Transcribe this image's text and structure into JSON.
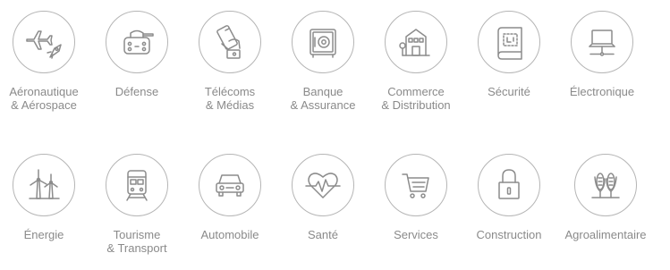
{
  "industries": [
    {
      "label": "Aéronautique\n& Aérospace",
      "icon": "airplane-rocket-icon"
    },
    {
      "label": "Défense",
      "icon": "tank-icon"
    },
    {
      "label": "Télécoms\n& Médias",
      "icon": "phone-hand-icon"
    },
    {
      "label": "Banque\n& Assurance",
      "icon": "safe-icon"
    },
    {
      "label": "Commerce\n& Distribution",
      "icon": "storefront-icon"
    },
    {
      "label": "Sécurité",
      "icon": "blueprint-icon"
    },
    {
      "label": "Électronique",
      "icon": "laptop-network-icon"
    },
    {
      "label": "Énergie",
      "icon": "wind-turbine-icon"
    },
    {
      "label": "Tourisme\n& Transport",
      "icon": "train-icon"
    },
    {
      "label": "Automobile",
      "icon": "car-icon"
    },
    {
      "label": "Santé",
      "icon": "heart-pulse-icon"
    },
    {
      "label": "Services",
      "icon": "shopping-cart-icon"
    },
    {
      "label": "Construction",
      "icon": "padlock-icon"
    },
    {
      "label": "Agroalimentaire",
      "icon": "corn-icon"
    }
  ]
}
